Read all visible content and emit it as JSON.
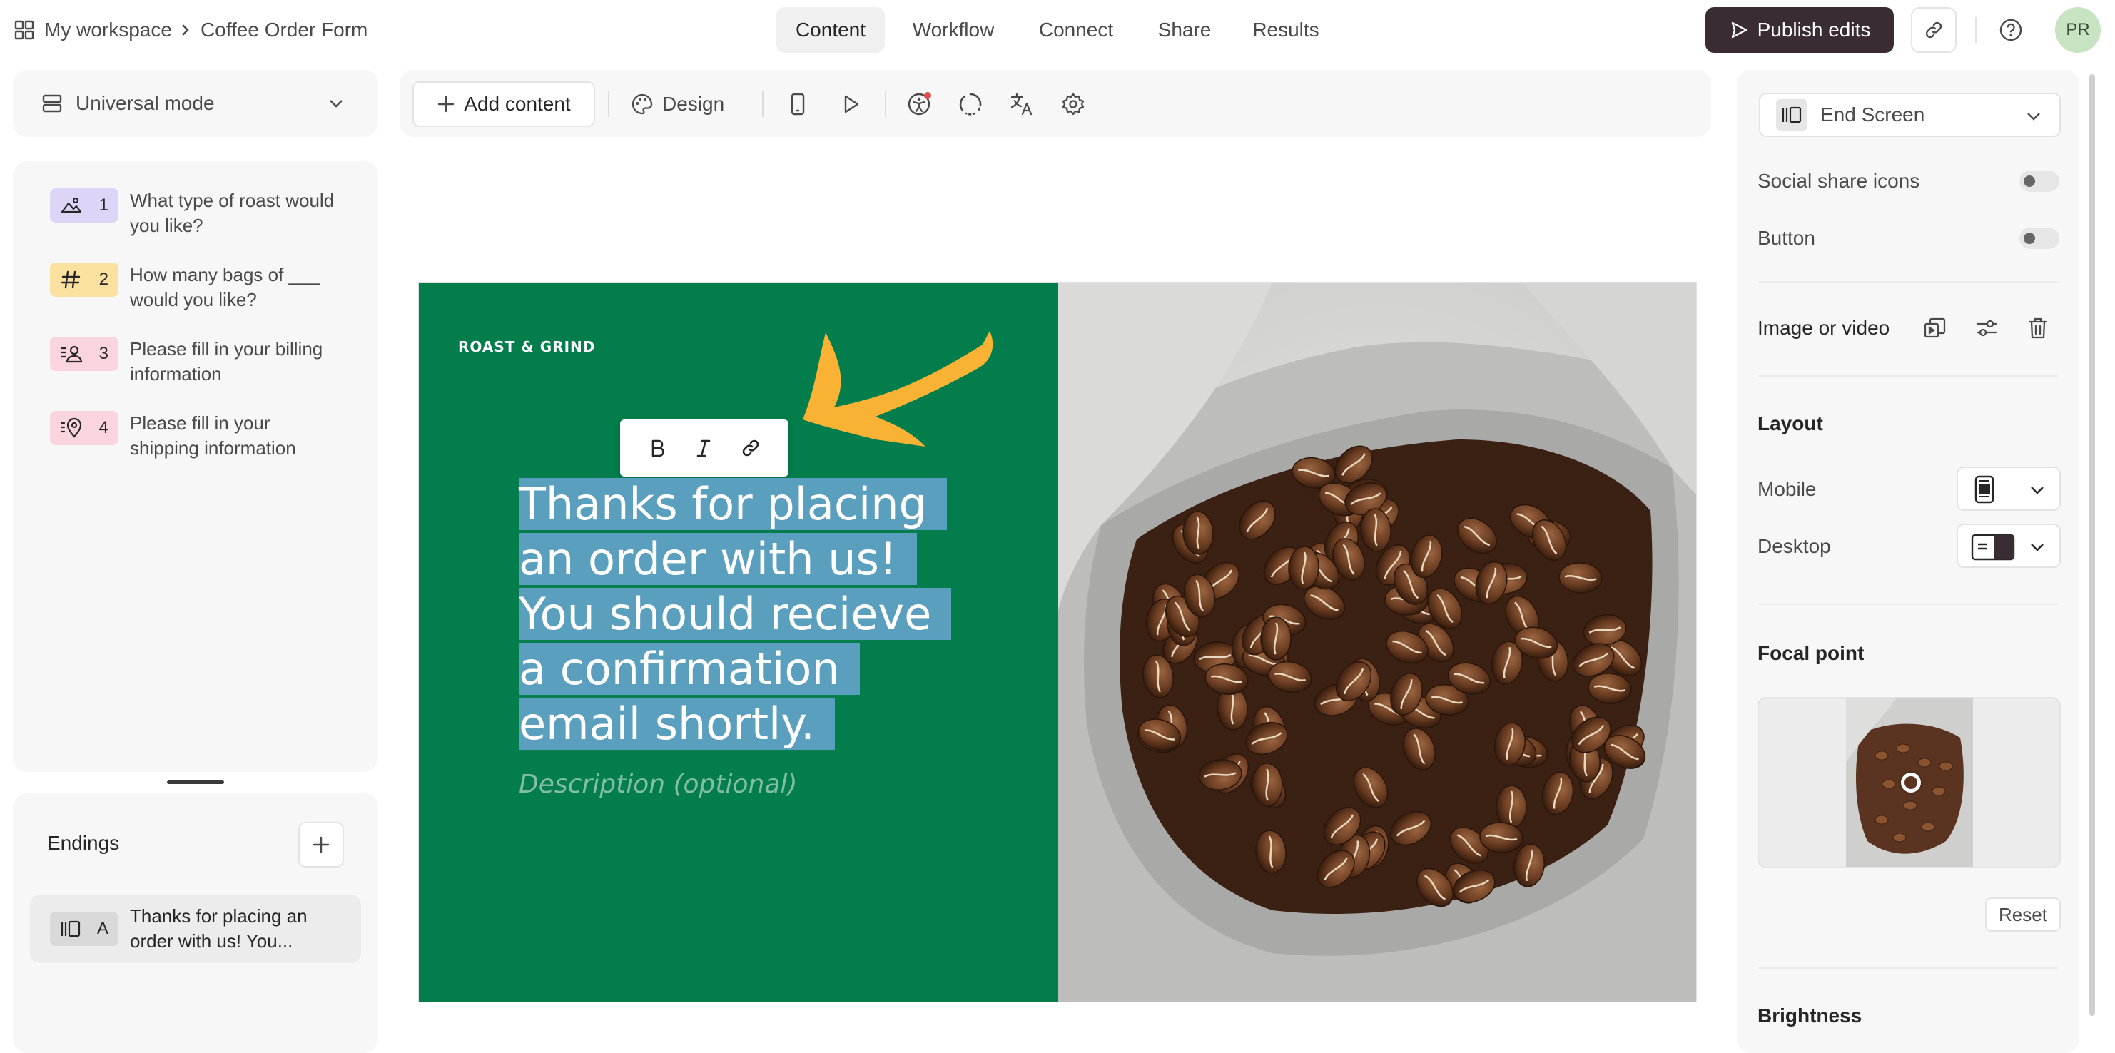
{
  "topbar": {
    "workspace_label": "My workspace",
    "form_name": "Coffee Order Form",
    "tabs": [
      {
        "label": "Content",
        "active": true
      },
      {
        "label": "Workflow",
        "active": false
      },
      {
        "label": "Connect",
        "active": false
      },
      {
        "label": "Share",
        "active": false
      },
      {
        "label": "Results",
        "active": false
      }
    ],
    "publish_label": "Publish edits",
    "avatar_initials": "PR"
  },
  "left": {
    "mode_label": "Universal mode",
    "questions": [
      {
        "number": "1",
        "text": "What type of roast would you like?",
        "icon": "picture-choice-icon",
        "color": "#ddd4f7"
      },
      {
        "number": "2",
        "text": "How many bags of ___ would you like?",
        "icon": "number-icon",
        "color": "#fbe1a0"
      },
      {
        "number": "3",
        "text": "Please fill in your billing information",
        "icon": "contact-info-icon",
        "color": "#fbd5dd"
      },
      {
        "number": "4",
        "text": "Please fill in your shipping information",
        "icon": "address-icon",
        "color": "#fbd5dd"
      }
    ],
    "endings_title": "Endings",
    "endings": [
      {
        "letter": "A",
        "text": "Thanks for placing an order with us! You...",
        "icon": "end-screen-icon"
      }
    ]
  },
  "toolbar": {
    "add_content_label": "Add content",
    "design_label": "Design",
    "icons": [
      "mobile-preview-icon",
      "play-icon",
      "accessibility-icon",
      "loading-icon",
      "translate-icon",
      "settings-icon"
    ]
  },
  "canvas": {
    "brand": "ROAST & GRIND",
    "headline": "Thanks for placing an order with us! You should recieve a confirmation email shortly.",
    "description_placeholder": "Description (optional)",
    "format_tools": [
      "bold-icon",
      "italic-icon",
      "link-icon"
    ],
    "colors": {
      "left_bg": "#037d4b",
      "selection": "#5b9fbf",
      "arrow": "#f9b233"
    }
  },
  "right": {
    "block_type": "End Screen",
    "social_share_label": "Social share icons",
    "social_share_on": false,
    "button_label": "Button",
    "button_on": false,
    "image_video_label": "Image or video",
    "layout_title": "Layout",
    "mobile_label": "Mobile",
    "desktop_label": "Desktop",
    "focal_title": "Focal point",
    "reset_label": "Reset",
    "brightness_title": "Brightness"
  }
}
